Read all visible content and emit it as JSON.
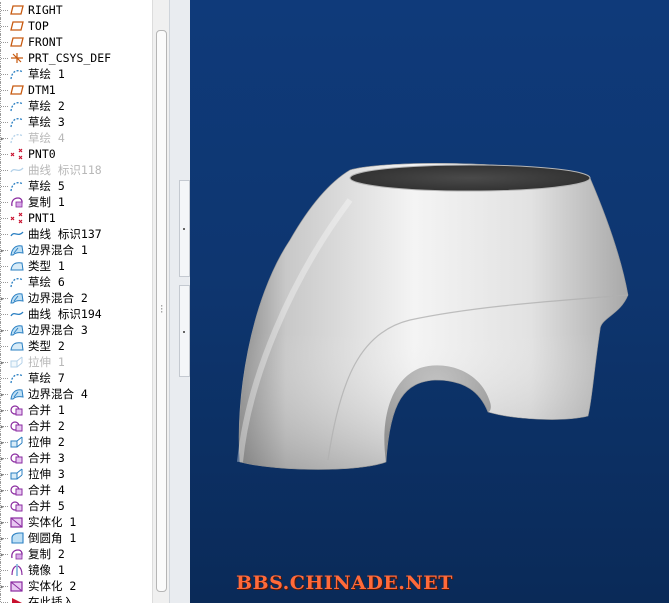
{
  "model_tree": {
    "items": [
      {
        "label": "RIGHT",
        "icon": "datum-plane-icon",
        "suppressed": false,
        "expandable": false
      },
      {
        "label": "TOP",
        "icon": "datum-plane-icon",
        "suppressed": false,
        "expandable": false
      },
      {
        "label": "FRONT",
        "icon": "datum-plane-icon",
        "suppressed": false,
        "expandable": false
      },
      {
        "label": "PRT_CSYS_DEF",
        "icon": "coordinate-system-icon",
        "suppressed": false,
        "expandable": false
      },
      {
        "label": "草绘 1",
        "icon": "sketch-icon",
        "suppressed": false,
        "expandable": false
      },
      {
        "label": "DTM1",
        "icon": "datum-plane-icon",
        "suppressed": false,
        "expandable": false
      },
      {
        "label": "草绘 2",
        "icon": "sketch-icon",
        "suppressed": false,
        "expandable": false
      },
      {
        "label": "草绘 3",
        "icon": "sketch-icon",
        "suppressed": false,
        "expandable": false
      },
      {
        "label": "草绘 4",
        "icon": "sketch-icon",
        "suppressed": true,
        "expandable": true
      },
      {
        "label": "PNT0",
        "icon": "datum-point-icon",
        "suppressed": false,
        "expandable": false
      },
      {
        "label": "曲线 标识118",
        "icon": "curve-icon",
        "suppressed": true,
        "expandable": false
      },
      {
        "label": "草绘 5",
        "icon": "sketch-icon",
        "suppressed": false,
        "expandable": false
      },
      {
        "label": "复制 1",
        "icon": "copy-icon",
        "suppressed": false,
        "expandable": false
      },
      {
        "label": "PNT1",
        "icon": "datum-point-icon",
        "suppressed": false,
        "expandable": false
      },
      {
        "label": "曲线 标识137",
        "icon": "curve-icon",
        "suppressed": false,
        "expandable": false
      },
      {
        "label": "边界混合 1",
        "icon": "boundary-blend-icon",
        "suppressed": false,
        "expandable": true
      },
      {
        "label": "类型 1",
        "icon": "surface-icon",
        "suppressed": false,
        "expandable": false
      },
      {
        "label": "草绘 6",
        "icon": "sketch-icon",
        "suppressed": false,
        "expandable": false
      },
      {
        "label": "边界混合 2",
        "icon": "boundary-blend-icon",
        "suppressed": false,
        "expandable": true
      },
      {
        "label": "曲线 标识194",
        "icon": "curve-icon",
        "suppressed": false,
        "expandable": false
      },
      {
        "label": "边界混合 3",
        "icon": "boundary-blend-icon",
        "suppressed": false,
        "expandable": true
      },
      {
        "label": "类型 2",
        "icon": "surface-icon",
        "suppressed": false,
        "expandable": false
      },
      {
        "label": "拉伸 1",
        "icon": "extrude-icon",
        "suppressed": true,
        "expandable": true
      },
      {
        "label": "草绘 7",
        "icon": "sketch-icon",
        "suppressed": false,
        "expandable": false
      },
      {
        "label": "边界混合 4",
        "icon": "boundary-blend-icon",
        "suppressed": false,
        "expandable": true
      },
      {
        "label": "合并 1",
        "icon": "merge-icon",
        "suppressed": false,
        "expandable": true
      },
      {
        "label": "合并 2",
        "icon": "merge-icon",
        "suppressed": false,
        "expandable": true
      },
      {
        "label": "拉伸 2",
        "icon": "extrude-icon",
        "suppressed": false,
        "expandable": true
      },
      {
        "label": "合并 3",
        "icon": "merge-icon",
        "suppressed": false,
        "expandable": true
      },
      {
        "label": "拉伸 3",
        "icon": "extrude-icon",
        "suppressed": false,
        "expandable": true
      },
      {
        "label": "合并 4",
        "icon": "merge-icon",
        "suppressed": false,
        "expandable": true
      },
      {
        "label": "合并 5",
        "icon": "merge-icon",
        "suppressed": false,
        "expandable": true
      },
      {
        "label": "实体化 1",
        "icon": "solidify-icon",
        "suppressed": false,
        "expandable": true
      },
      {
        "label": "倒圆角 1",
        "icon": "round-icon",
        "suppressed": false,
        "expandable": true
      },
      {
        "label": "复制 2",
        "icon": "copy-icon",
        "suppressed": false,
        "expandable": true
      },
      {
        "label": "镜像 1",
        "icon": "mirror-icon",
        "suppressed": false,
        "expandable": false
      },
      {
        "label": "实体化 2",
        "icon": "solidify-icon",
        "suppressed": false,
        "expandable": true
      },
      {
        "label": "在此插入",
        "icon": "insert-here-icon",
        "suppressed": false,
        "expandable": false
      }
    ]
  },
  "viewport": {
    "watermark": "BBS.CHINADE.NET",
    "background_top": "#0f3a7a",
    "background_bottom": "#0a2a58",
    "model_color": "#d8d8d8"
  },
  "colors": {
    "icon_blue": "#2a7fc2",
    "icon_red": "#c8102e",
    "icon_orange": "#c85a10",
    "icon_purple": "#8a2aa0",
    "suppressed_text": "#b8b8b8"
  }
}
